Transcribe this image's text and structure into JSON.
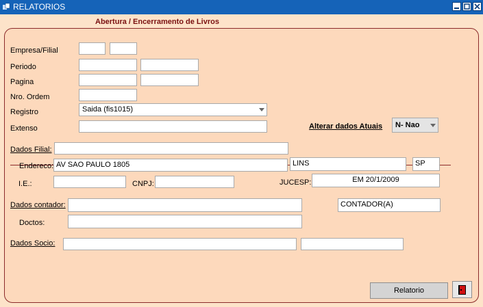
{
  "window": {
    "title": "RELATORIOS",
    "app_icon": "app-icon",
    "controls": [
      "minimize-icon",
      "maximize-icon",
      "close-icon"
    ]
  },
  "form": {
    "heading": "Abertura / Encerramento de Livros",
    "labels": {
      "empresa_filial": "Empresa/Filial",
      "periodo": "Periodo",
      "pagina": "Pagina",
      "nro_ordem": "Nro. Ordem",
      "registro": "Registro",
      "extenso": "Extenso",
      "alterar": "Alterar dados Atuais",
      "dados_filial": "Dados Filial:",
      "endereco": "Endereco:",
      "ie": "I.E.:",
      "cnpj": "CNPJ:",
      "jucesp": "JUCESP:",
      "dados_contador": "Dados contador:",
      "doctos": "Doctos:",
      "dados_socio": "Dados Socio:"
    },
    "values": {
      "registro": "Saida (fis1015)",
      "alterar": "N- Nao",
      "endereco": "AV SAO PAULO  1805",
      "cidade": "LINS",
      "uf": "SP",
      "jucesp": "EM  20/1/2009",
      "contador_cargo": "CONTADOR(A)"
    },
    "buttons": {
      "relatorio": "Relatorio"
    },
    "colors": {
      "titlebar": "#1563b8",
      "background": "#fde3c9",
      "panel": "#fdd9bc",
      "accent": "#8b2a2a"
    }
  }
}
